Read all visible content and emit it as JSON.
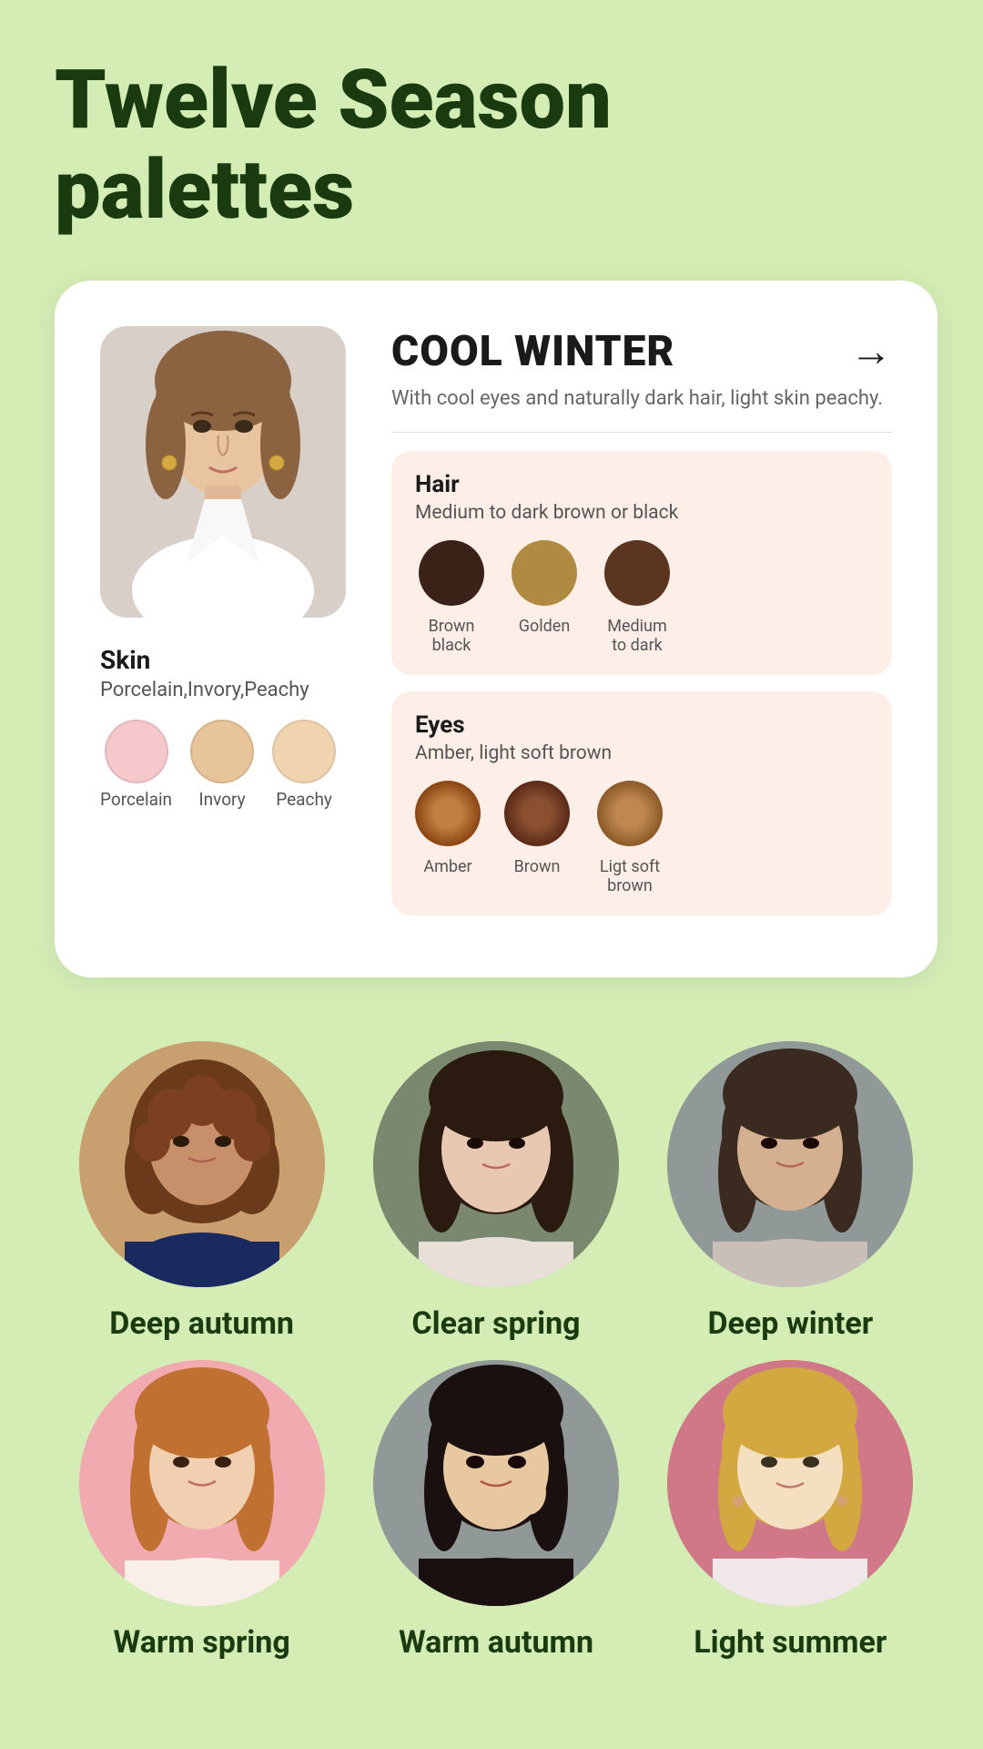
{
  "page": {
    "title_line1": "Twelve Season",
    "title_line2": "palettes",
    "background_color": "#d4edb5"
  },
  "card": {
    "season_name": "COOL WINTER",
    "season_desc": "With cool eyes and naturally dark hair, light skin peachy.",
    "arrow": "→",
    "skin": {
      "label": "Skin",
      "types": "Porcelain,Invory,Peachy",
      "swatches": [
        {
          "name": "Porcelain",
          "color": "#f5c8cc"
        },
        {
          "name": "Invory",
          "color": "#e8c49a"
        },
        {
          "name": "Peachy",
          "color": "#f0d4b0"
        }
      ]
    },
    "hair": {
      "label": "Hair",
      "subtitle": "Medium to dark brown or black",
      "swatches": [
        {
          "name": "Brown black",
          "color": "#3a2218"
        },
        {
          "name": "Golden",
          "color": "#b08a40"
        },
        {
          "name": "Medium to dark",
          "color": "#5c3520"
        }
      ]
    },
    "eyes": {
      "label": "Eyes",
      "subtitle": "Amber, light soft brown",
      "swatches": [
        {
          "name": "Amber",
          "color": "#8B4513"
        },
        {
          "name": "Brown",
          "color": "#6B3A2A"
        },
        {
          "name": "Ligt soft brown",
          "color": "#A0622A"
        }
      ]
    }
  },
  "seasons_row1": [
    {
      "label": "Deep autumn",
      "bg": "#c4a882"
    },
    {
      "label": "Clear spring",
      "bg": "#7a8c80"
    },
    {
      "label": "Deep winter",
      "bg": "#8a9490"
    }
  ],
  "seasons_row2": [
    {
      "label": "Warm spring",
      "bg": "#f0aab0"
    },
    {
      "label": "Warm autumn",
      "bg": "#909898"
    },
    {
      "label": "Light summer",
      "bg": "#c8a0a8"
    }
  ]
}
